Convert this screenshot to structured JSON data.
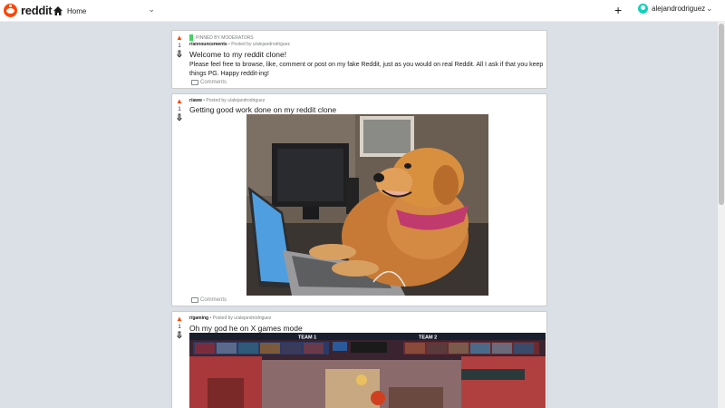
{
  "header": {
    "logo_text": "reddit",
    "home_label": "Home",
    "username": "alejandrodriguez"
  },
  "posts": [
    {
      "pinned_label": "PINNED BY MODERATORS",
      "subreddit": "r/announcements",
      "posted_by": " • Posted by u/alejandrodriguez",
      "score": "1",
      "title": "Welcome to my reddit clone!",
      "body": "Please feel free to browse, like, comment or post on my fake Reddit, just as you would on real Reddit. All I ask if that you keep things PG. Happy reddit-ing!",
      "comments_label": "Comments"
    },
    {
      "subreddit": "r/aww",
      "posted_by": " • Posted by u/alejandrodriguez",
      "score": "1",
      "title": "Getting good work done on my reddit clone",
      "comments_label": "Comments"
    },
    {
      "subreddit": "r/gaming",
      "posted_by": " • Posted by u/alejandrodriguez",
      "score": "1",
      "title": "Oh my god he on X games mode",
      "team1_label": "TEAM 1",
      "team2_label": "TEAM 2"
    }
  ],
  "icons": {
    "home": "home-icon",
    "plus": "plus-icon",
    "chevron": "chevron-down-icon",
    "upvote": "upvote-icon",
    "downvote": "downvote-icon",
    "comment": "comment-icon"
  },
  "colors": {
    "brand": "#ff4500",
    "background": "#dae0e6",
    "pinned": "#46d160",
    "avatar": "#0dd3bb"
  }
}
